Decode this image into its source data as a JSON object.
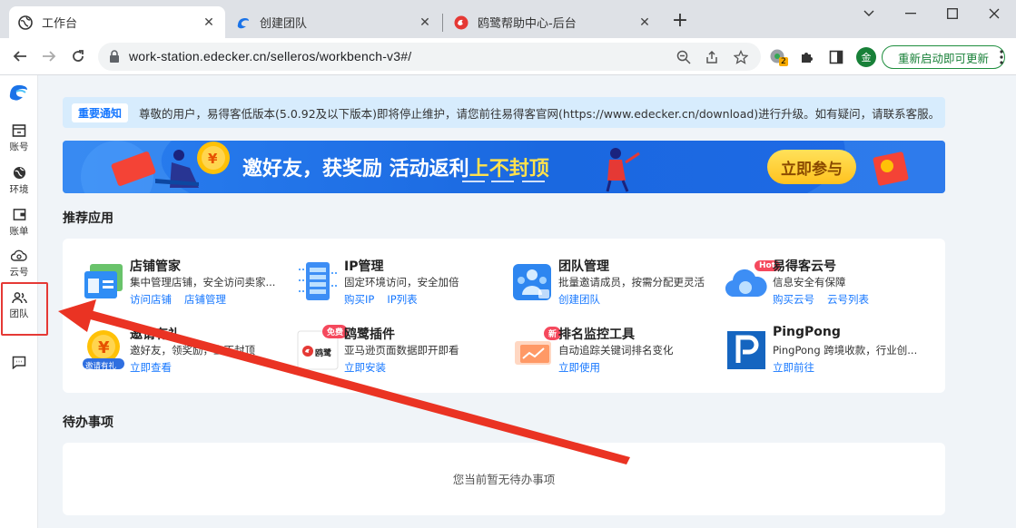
{
  "browser": {
    "tabs": [
      {
        "title": "工作台",
        "active": true
      },
      {
        "title": "创建团队",
        "active": false
      },
      {
        "title": "鸥鹭帮助中心-后台",
        "active": false
      }
    ],
    "url": "work-station.edecker.cn/selleros/workbench-v3#/",
    "extension_badge": "2",
    "profile_initial": "金",
    "update_button": "重新启动即可更新"
  },
  "sidebar": {
    "items": [
      {
        "label": "账号"
      },
      {
        "label": "环境"
      },
      {
        "label": "账单"
      },
      {
        "label": "云号"
      },
      {
        "label": "团队"
      }
    ]
  },
  "notice": {
    "tag": "重要通知",
    "text": "尊敬的用户，易得客低版本(5.0.92及以下版本)即将停止维护，请您前往易得客官网(https://www.edecker.cn/download)进行升级。如有疑问，请联系客服。"
  },
  "banner": {
    "text_prefix": "邀好友，获奖励 ",
    "text_mid": "活动返利",
    "text_highlight": "上不封顶",
    "button": "立即参与"
  },
  "recommended": {
    "title": "推荐应用",
    "apps": [
      {
        "name": "店铺管家",
        "desc": "集中管理店铺，安全访问卖家...",
        "links": [
          "访问店铺",
          "店铺管理"
        ]
      },
      {
        "name": "IP管理",
        "desc": "固定环境访问，安全加倍",
        "links": [
          "购买IP",
          "IP列表"
        ]
      },
      {
        "name": "团队管理",
        "desc": "批量邀请成员，按需分配更灵活",
        "links": [
          "创建团队"
        ]
      },
      {
        "name": "易得客云号",
        "desc": "信息安全有保障",
        "links": [
          "购买云号",
          "云号列表"
        ],
        "badge": "Hot"
      },
      {
        "name": "邀请有礼",
        "desc": "邀好友，领奖励，上不封顶",
        "links": [
          "立即查看"
        ],
        "icon_text": "邀请有礼"
      },
      {
        "name": "鸥鹭插件",
        "desc": "亚马逊页面数据即开即看",
        "links": [
          "立即安装"
        ],
        "badge": "免费",
        "icon_text": "鸥鹭"
      },
      {
        "name": "排名监控工具",
        "desc": "自动追踪关键词排名变化",
        "links": [
          "立即使用"
        ],
        "badge": "新"
      },
      {
        "name": "PingPong",
        "desc": "PingPong 跨境收款，行业创...",
        "links": [
          "立即前往"
        ]
      }
    ]
  },
  "todo": {
    "title": "待办事项",
    "empty": "您当前暂无待办事项"
  },
  "colors": {
    "accent": "#1677ff",
    "annotation": "#e53935",
    "update_green": "#188038"
  }
}
